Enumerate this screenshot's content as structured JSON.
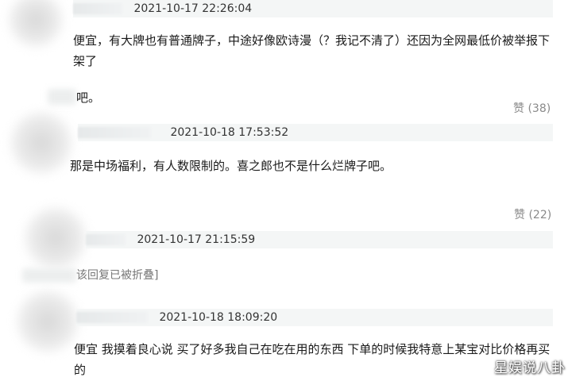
{
  "comments": [
    {
      "timestamp": "2021-10-17 22:26:04",
      "text_line1": "便宜，有大牌也有普通牌子，中途好像欧诗漫（？我记不清了）还因为全网最低价被举报下",
      "text_line2": "架了",
      "reply_snippet": "吧。",
      "likes": "赞 (38)"
    },
    {
      "timestamp": "2021-10-18 17:53:52",
      "text": "那是中场福利，有人数限制的。喜之郎也不是什么烂牌子吧。",
      "likes": "赞 (22)"
    },
    {
      "timestamp": "2021-10-17 21:15:59",
      "folded_notice": "该回复已被折叠]"
    },
    {
      "timestamp": "2021-10-18 18:09:20",
      "text_line1": "便宜 我摸着良心说 买了好多我自己在吃在用的东西 下单的时候我特意上某宝对比价格再买",
      "text_line2": "的"
    }
  ],
  "watermark": "星娱说八卦"
}
